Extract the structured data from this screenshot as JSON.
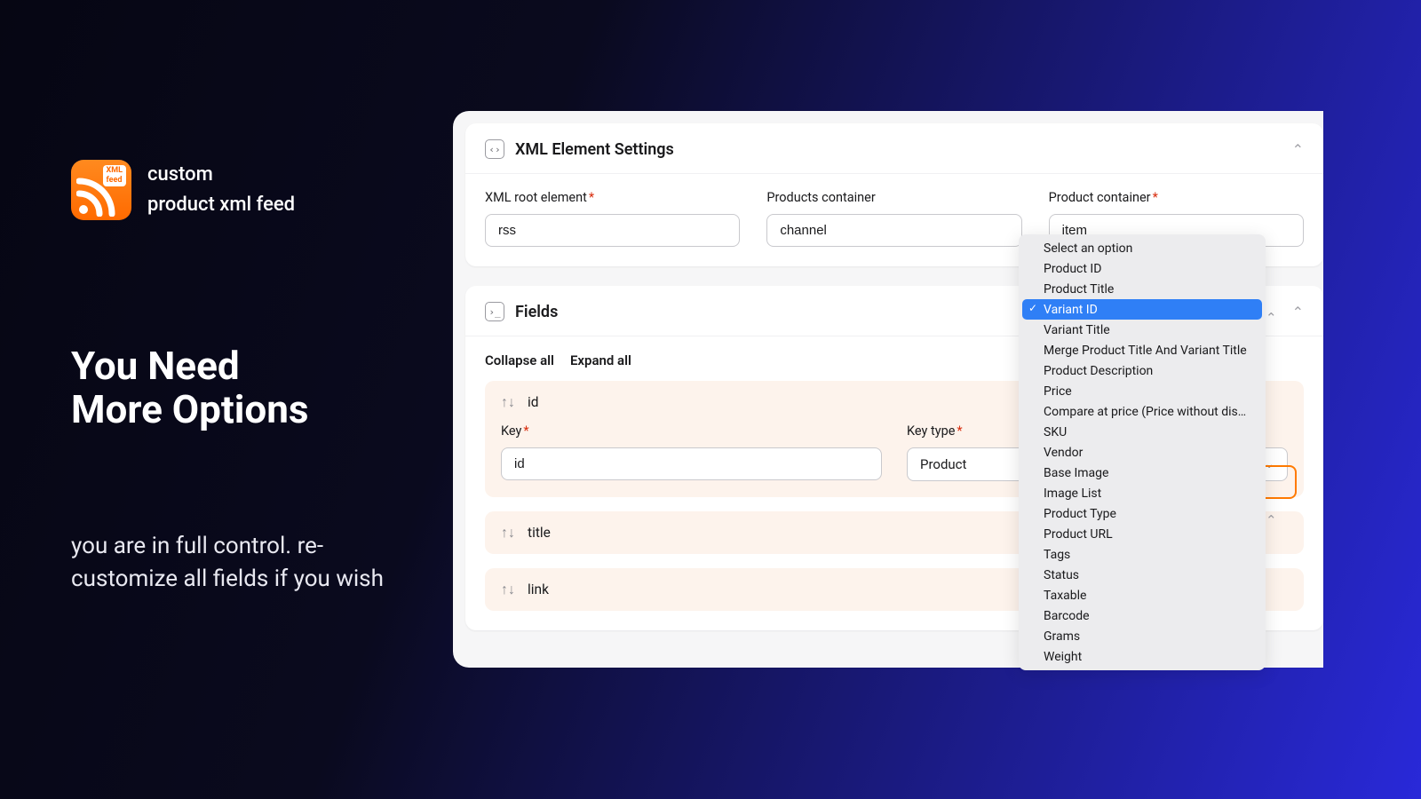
{
  "brand": {
    "line1": "custom",
    "line2": "product xml feed",
    "badge": "XML\nfeed"
  },
  "headline": {
    "line1": "You Need",
    "line2": "More Options"
  },
  "subtext": "you are in full control. re-customize all fields if you wish",
  "settings": {
    "title": "XML Element Settings",
    "root_label": "XML root element",
    "root_value": "rss",
    "products_label": "Products container",
    "products_value": "channel",
    "product_label": "Product container",
    "product_value": "item"
  },
  "fields": {
    "title": "Fields",
    "collapse": "Collapse all",
    "expand": "Expand all",
    "key_label": "Key",
    "keytype_label": "Key type",
    "id_field": {
      "name": "id",
      "key": "id",
      "keytype": "Product"
    },
    "title_field": {
      "name": "title"
    },
    "link_field": {
      "name": "link"
    }
  },
  "dropdown": {
    "options": [
      "Select an option",
      "Product ID",
      "Product Title",
      "Variant ID",
      "Variant Title",
      "Merge Product Title And Variant Title",
      "Product Description",
      "Price",
      "Compare at price (Price without discount)",
      "SKU",
      "Vendor",
      "Base Image",
      "Image List",
      "Product Type",
      "Product URL",
      "Tags",
      "Status",
      "Taxable",
      "Barcode",
      "Grams",
      "Weight"
    ],
    "selected": "Variant ID"
  }
}
